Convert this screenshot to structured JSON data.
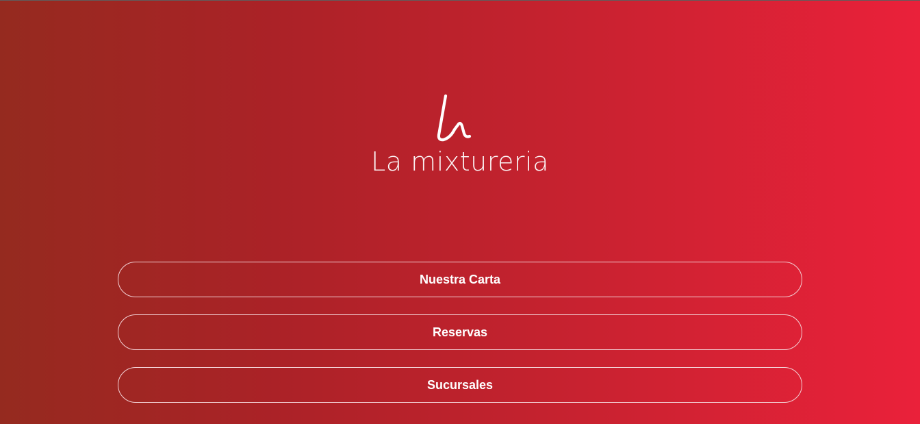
{
  "brand": {
    "name": "La mixtureria",
    "logo_icon": "la-mixtureria-logo-mark"
  },
  "menu": {
    "items": [
      {
        "label": "Nuestra Carta"
      },
      {
        "label": "Reservas"
      },
      {
        "label": "Sucursales"
      }
    ]
  },
  "colors": {
    "gradient_start": "#952a1f",
    "gradient_end": "#ea213a",
    "button_border": "#f3d2d6",
    "text": "#ffffff"
  }
}
